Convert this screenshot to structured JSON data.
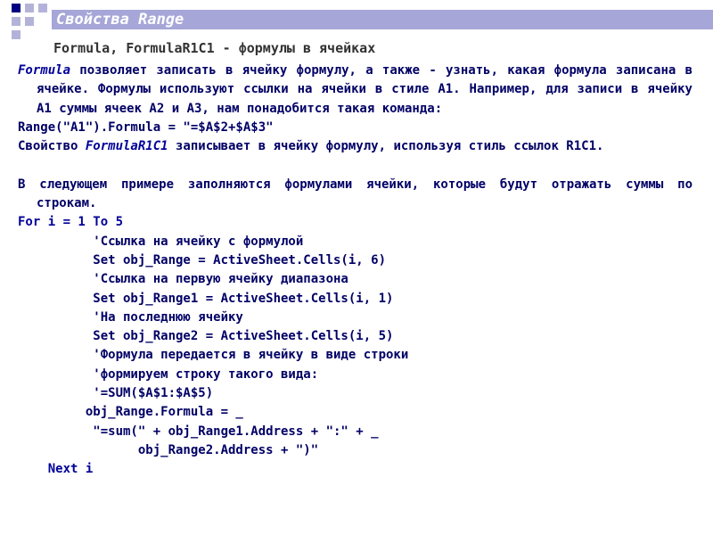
{
  "slide": {
    "title": "Свойства Range",
    "subtitle": "Formula, FormulaR1C1 - формулы в ячейках",
    "colors": {
      "title_bar": "#a6a6d8",
      "accent_dark": "#000080",
      "accent_light": "#b3b3d9",
      "text": "#000066"
    }
  },
  "body": {
    "p1": {
      "em": "Formula",
      "text": " позволяет записать в ячейку формулу, а также - узнать, какая формула записана в ячейке. Формулы используют ссылки на ячейки в стиле A1. Например, для записи в ячейку A1 суммы ячеек A2 и A3, нам понадобится такая команда:"
    },
    "code1": "Range(\"A1\").Formula = \"=$A$2+$A$3\"",
    "p2": {
      "pre": "Свойство ",
      "em": "FormulaR1C1",
      "post": " записывает в ячейку формулу, используя стиль ссылок R1C1."
    },
    "p3": "В следующем примере заполняются формулами ячейки, которые будут отражать суммы по строкам.",
    "code_lines": [
      "For i = 1 To 5",
      "          'Ссылка на ячейку с формулой",
      "          Set obj_Range = ActiveSheet.Cells(i, 6)",
      "          'Ссылка на первую ячейку диапазона",
      "          Set obj_Range1 = ActiveSheet.Cells(i, 1)",
      "          'На последнюю ячейку",
      "          Set obj_Range2 = ActiveSheet.Cells(i, 5)",
      "          'Формула передается в ячейку в виде строки",
      "          'формируем строку такого вида:",
      "          '=SUM($A$1:$A$5)",
      "         obj_Range.Formula = _",
      "          \"=sum(\" + obj_Range1.Address + \":\" + _",
      "                obj_Range2.Address + \")\"",
      "    Next i"
    ]
  }
}
